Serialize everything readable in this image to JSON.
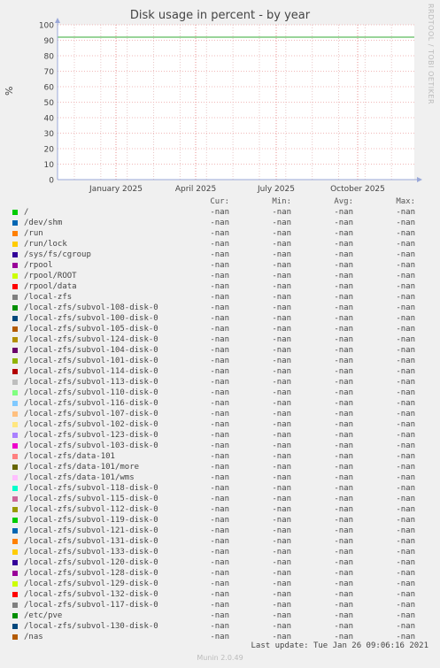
{
  "chart_data": {
    "type": "line",
    "title": "Disk usage in percent - by year",
    "ylabel": "%",
    "ylim": [
      0,
      100
    ],
    "y_ticks": [
      "0",
      "10",
      "20",
      "30",
      "40",
      "50",
      "60",
      "70",
      "80",
      "90",
      "100"
    ],
    "x_ticks": [
      "January 2025",
      "April 2025",
      "July 2025",
      "October 2025"
    ],
    "grid": true,
    "warning_line": 92,
    "warning_line_color": "#33aa33",
    "side_label": "RRDTOOL / TOBI OETIKER",
    "columns": [
      "Cur:",
      "Min:",
      "Avg:",
      "Max:"
    ],
    "series": [
      {
        "name": "/",
        "color": "#00cc00",
        "cur": "-nan",
        "min": "-nan",
        "avg": "-nan",
        "max": "-nan"
      },
      {
        "name": "/dev/shm",
        "color": "#0066b3",
        "cur": "-nan",
        "min": "-nan",
        "avg": "-nan",
        "max": "-nan"
      },
      {
        "name": "/run",
        "color": "#ff8000",
        "cur": "-nan",
        "min": "-nan",
        "avg": "-nan",
        "max": "-nan"
      },
      {
        "name": "/run/lock",
        "color": "#ffcc00",
        "cur": "-nan",
        "min": "-nan",
        "avg": "-nan",
        "max": "-nan"
      },
      {
        "name": "/sys/fs/cgroup",
        "color": "#330099",
        "cur": "-nan",
        "min": "-nan",
        "avg": "-nan",
        "max": "-nan"
      },
      {
        "name": "/rpool",
        "color": "#990099",
        "cur": "-nan",
        "min": "-nan",
        "avg": "-nan",
        "max": "-nan"
      },
      {
        "name": "/rpool/ROOT",
        "color": "#ccff00",
        "cur": "-nan",
        "min": "-nan",
        "avg": "-nan",
        "max": "-nan"
      },
      {
        "name": "/rpool/data",
        "color": "#ff0000",
        "cur": "-nan",
        "min": "-nan",
        "avg": "-nan",
        "max": "-nan"
      },
      {
        "name": "/local-zfs",
        "color": "#808080",
        "cur": "-nan",
        "min": "-nan",
        "avg": "-nan",
        "max": "-nan"
      },
      {
        "name": "/local-zfs/subvol-108-disk-0",
        "color": "#008f00",
        "cur": "-nan",
        "min": "-nan",
        "avg": "-nan",
        "max": "-nan"
      },
      {
        "name": "/local-zfs/subvol-100-disk-0",
        "color": "#00487d",
        "cur": "-nan",
        "min": "-nan",
        "avg": "-nan",
        "max": "-nan"
      },
      {
        "name": "/local-zfs/subvol-105-disk-0",
        "color": "#b35a00",
        "cur": "-nan",
        "min": "-nan",
        "avg": "-nan",
        "max": "-nan"
      },
      {
        "name": "/local-zfs/subvol-124-disk-0",
        "color": "#b38f00",
        "cur": "-nan",
        "min": "-nan",
        "avg": "-nan",
        "max": "-nan"
      },
      {
        "name": "/local-zfs/subvol-104-disk-0",
        "color": "#6b006b",
        "cur": "-nan",
        "min": "-nan",
        "avg": "-nan",
        "max": "-nan"
      },
      {
        "name": "/local-zfs/subvol-101-disk-0",
        "color": "#8fb300",
        "cur": "-nan",
        "min": "-nan",
        "avg": "-nan",
        "max": "-nan"
      },
      {
        "name": "/local-zfs/subvol-114-disk-0",
        "color": "#b30000",
        "cur": "-nan",
        "min": "-nan",
        "avg": "-nan",
        "max": "-nan"
      },
      {
        "name": "/local-zfs/subvol-113-disk-0",
        "color": "#bebebe",
        "cur": "-nan",
        "min": "-nan",
        "avg": "-nan",
        "max": "-nan"
      },
      {
        "name": "/local-zfs/subvol-110-disk-0",
        "color": "#80ff80",
        "cur": "-nan",
        "min": "-nan",
        "avg": "-nan",
        "max": "-nan"
      },
      {
        "name": "/local-zfs/subvol-116-disk-0",
        "color": "#80c9ff",
        "cur": "-nan",
        "min": "-nan",
        "avg": "-nan",
        "max": "-nan"
      },
      {
        "name": "/local-zfs/subvol-107-disk-0",
        "color": "#ffc080",
        "cur": "-nan",
        "min": "-nan",
        "avg": "-nan",
        "max": "-nan"
      },
      {
        "name": "/local-zfs/subvol-102-disk-0",
        "color": "#ffe680",
        "cur": "-nan",
        "min": "-nan",
        "avg": "-nan",
        "max": "-nan"
      },
      {
        "name": "/local-zfs/subvol-123-disk-0",
        "color": "#aa80ff",
        "cur": "-nan",
        "min": "-nan",
        "avg": "-nan",
        "max": "-nan"
      },
      {
        "name": "/local-zfs/subvol-103-disk-0",
        "color": "#ee00cc",
        "cur": "-nan",
        "min": "-nan",
        "avg": "-nan",
        "max": "-nan"
      },
      {
        "name": "/local-zfs/data-101",
        "color": "#ff8080",
        "cur": "-nan",
        "min": "-nan",
        "avg": "-nan",
        "max": "-nan"
      },
      {
        "name": "/local-zfs/data-101/more",
        "color": "#666600",
        "cur": "-nan",
        "min": "-nan",
        "avg": "-nan",
        "max": "-nan"
      },
      {
        "name": "/local-zfs/data-101/wms",
        "color": "#ffbfff",
        "cur": "-nan",
        "min": "-nan",
        "avg": "-nan",
        "max": "-nan"
      },
      {
        "name": "/local-zfs/subvol-118-disk-0",
        "color": "#00ffcc",
        "cur": "-nan",
        "min": "-nan",
        "avg": "-nan",
        "max": "-nan"
      },
      {
        "name": "/local-zfs/subvol-115-disk-0",
        "color": "#cc6699",
        "cur": "-nan",
        "min": "-nan",
        "avg": "-nan",
        "max": "-nan"
      },
      {
        "name": "/local-zfs/subvol-112-disk-0",
        "color": "#999900",
        "cur": "-nan",
        "min": "-nan",
        "avg": "-nan",
        "max": "-nan"
      },
      {
        "name": "/local-zfs/subvol-119-disk-0",
        "color": "#00cc00",
        "cur": "-nan",
        "min": "-nan",
        "avg": "-nan",
        "max": "-nan"
      },
      {
        "name": "/local-zfs/subvol-121-disk-0",
        "color": "#0066b3",
        "cur": "-nan",
        "min": "-nan",
        "avg": "-nan",
        "max": "-nan"
      },
      {
        "name": "/local-zfs/subvol-131-disk-0",
        "color": "#ff8000",
        "cur": "-nan",
        "min": "-nan",
        "avg": "-nan",
        "max": "-nan"
      },
      {
        "name": "/local-zfs/subvol-133-disk-0",
        "color": "#ffcc00",
        "cur": "-nan",
        "min": "-nan",
        "avg": "-nan",
        "max": "-nan"
      },
      {
        "name": "/local-zfs/subvol-120-disk-0",
        "color": "#330099",
        "cur": "-nan",
        "min": "-nan",
        "avg": "-nan",
        "max": "-nan"
      },
      {
        "name": "/local-zfs/subvol-128-disk-0",
        "color": "#990099",
        "cur": "-nan",
        "min": "-nan",
        "avg": "-nan",
        "max": "-nan"
      },
      {
        "name": "/local-zfs/subvol-129-disk-0",
        "color": "#ccff00",
        "cur": "-nan",
        "min": "-nan",
        "avg": "-nan",
        "max": "-nan"
      },
      {
        "name": "/local-zfs/subvol-132-disk-0",
        "color": "#ff0000",
        "cur": "-nan",
        "min": "-nan",
        "avg": "-nan",
        "max": "-nan"
      },
      {
        "name": "/local-zfs/subvol-117-disk-0",
        "color": "#808080",
        "cur": "-nan",
        "min": "-nan",
        "avg": "-nan",
        "max": "-nan"
      },
      {
        "name": "/etc/pve",
        "color": "#008f00",
        "cur": "-nan",
        "min": "-nan",
        "avg": "-nan",
        "max": "-nan"
      },
      {
        "name": "/local-zfs/subvol-130-disk-0",
        "color": "#00487d",
        "cur": "-nan",
        "min": "-nan",
        "avg": "-nan",
        "max": "-nan"
      },
      {
        "name": "/nas",
        "color": "#b35a00",
        "cur": "-nan",
        "min": "-nan",
        "avg": "-nan",
        "max": "-nan"
      }
    ]
  },
  "last_update": "Last update: Tue Jan 26 09:06:16 2021",
  "footer": "Munin 2.0.49"
}
